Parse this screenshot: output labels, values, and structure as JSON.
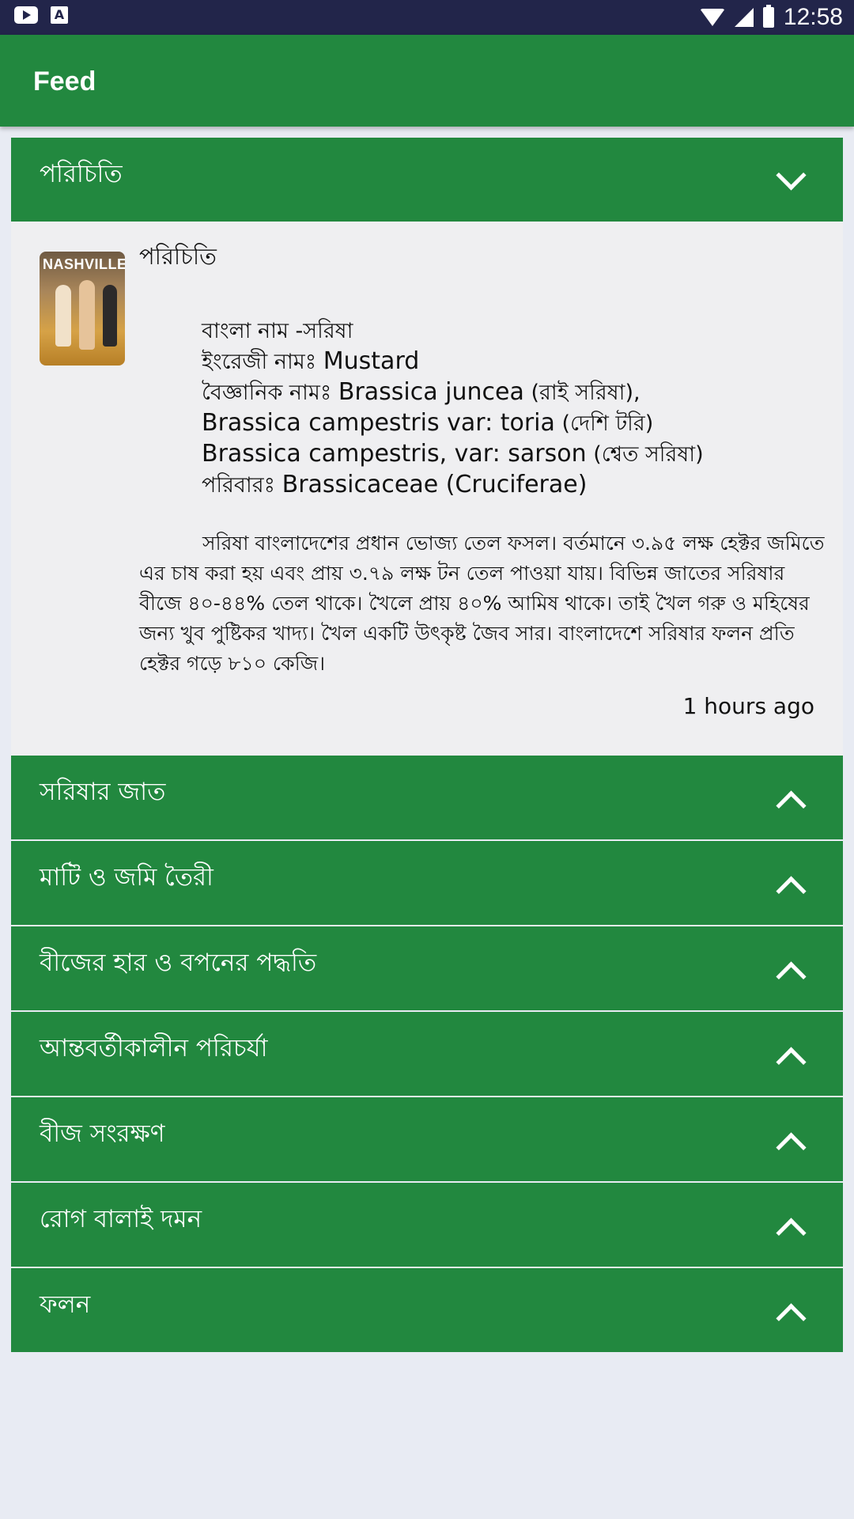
{
  "statusbar": {
    "time": "12:58",
    "icons": [
      "youtube-icon",
      "text-a-icon",
      "wifi-icon",
      "signal-icon",
      "battery-icon"
    ]
  },
  "appbar": {
    "title": "Feed"
  },
  "sections": [
    {
      "title": "পরিচিতি",
      "expanded": true
    },
    {
      "title": "সরিষার জাত",
      "expanded": false
    },
    {
      "title": "মাটি ও জমি তৈরী",
      "expanded": false
    },
    {
      "title": "বীজের হার ও বপনের পদ্ধতি",
      "expanded": false
    },
    {
      "title": "আন্তবর্তীকালীন পরিচর্যা",
      "expanded": false
    },
    {
      "title": "বীজ সংরক্ষণ",
      "expanded": false
    },
    {
      "title": "রোগ বালাই দমন",
      "expanded": false
    },
    {
      "title": "ফলন",
      "expanded": false
    }
  ],
  "post": {
    "thumbnail_text": "NASHVILLE",
    "title": "পরিচিতি",
    "bangla_name": "বাংলা নাম -সরিষা",
    "english_name_label": "ইংরেজী নামঃ",
    "english_name": "Mustard",
    "sci_label": "বৈজ্ঞানিক নামঃ",
    "sci_1": "Brassica juncea",
    "sci_1_note": "(রাই সরিষা),",
    "sci_2": "Brassica campestris var: toria",
    "sci_2_note": "(দেশি টরি)",
    "sci_3": "Brassica campestris, var: sarson",
    "sci_3_note": "(শ্বেত সরিষা)",
    "family_label": "পরিবারঃ",
    "family": "Brassicaceae (Cruciferae)",
    "description": "সরিষা বাংলাদেশের প্রধান ভোজ্য তেল ফসল। বর্তমানে ৩.৯৫ লক্ষ হেক্টর জমিতে এর চাষ করা হয় এবং প্রায় ৩.৭৯ লক্ষ টন তেল পাওয়া যায়। বিভিন্ন জাতের সরিষার বীজে ৪০-৪৪% তেল থাকে। খৈলে প্রায় ৪০% আমিষ থাকে। তাই খৈল গরু ও মহিষের জন্য খুব পুষ্টিকর খাদ্য। খৈল একটি উৎকৃষ্ট জৈব সার। বাংলাদেশে সরিষার ফলন প্রতি হেক্টর গড়ে ৮১০ কেজি।",
    "time_ago": "1 hours ago"
  }
}
